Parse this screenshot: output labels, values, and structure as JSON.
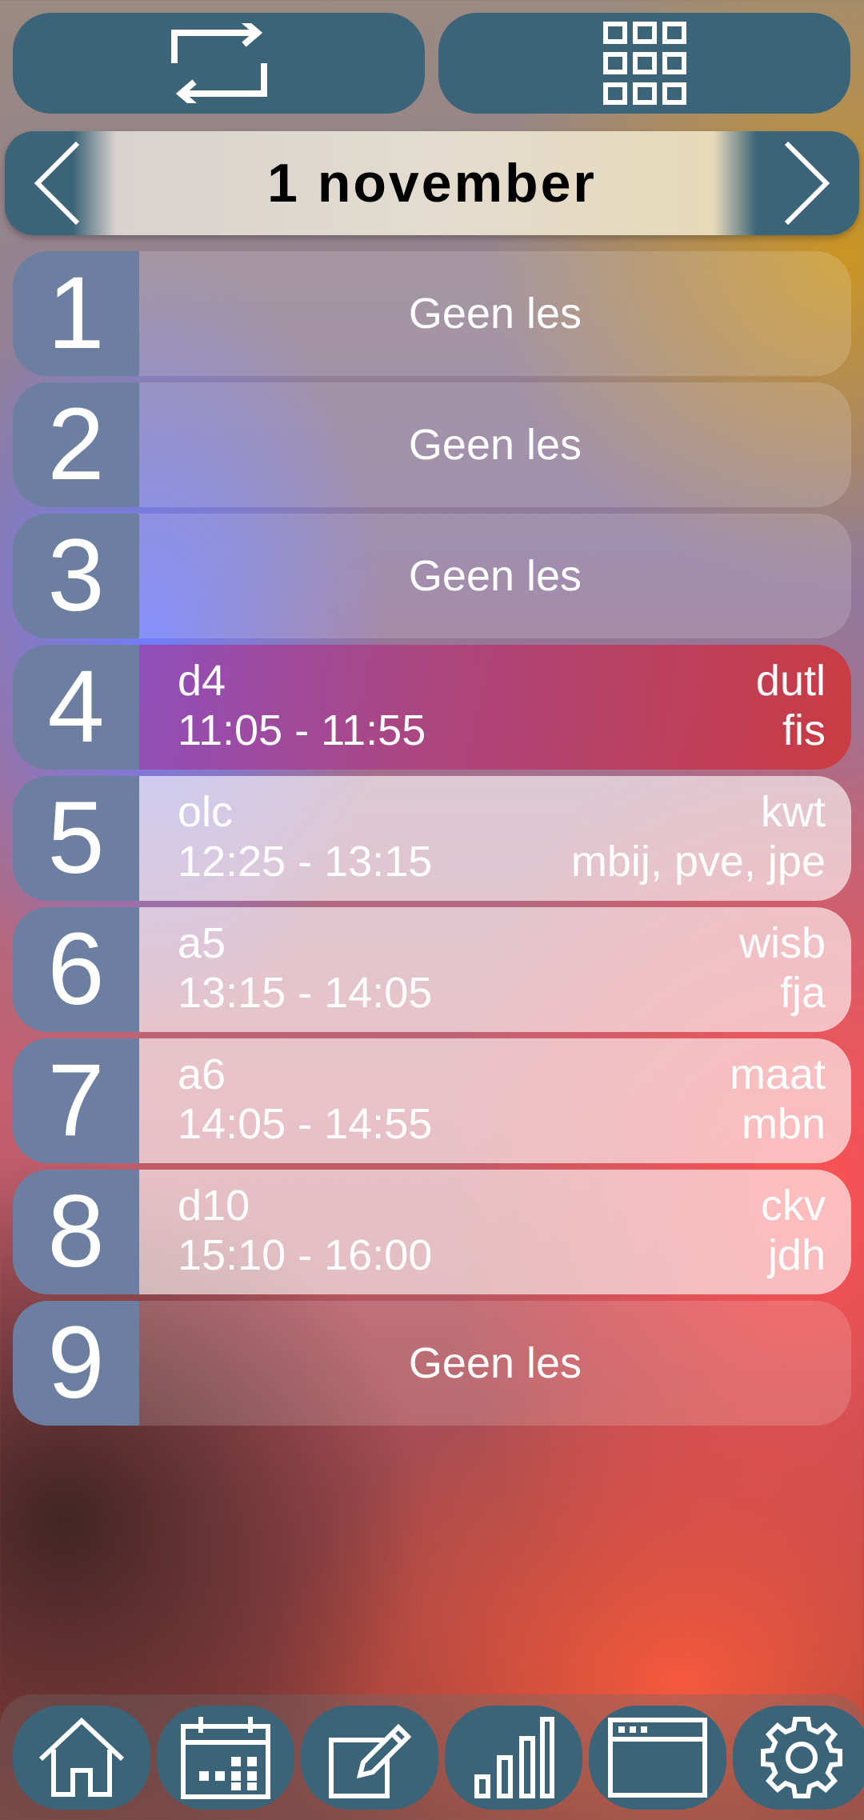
{
  "header": {
    "repeat_button_icon": "repeat-icon",
    "grid_button_icon": "grid-icon"
  },
  "datebar": {
    "date": "1 november",
    "prev_icon": "chevron-left-icon",
    "next_icon": "chevron-right-icon"
  },
  "lessons": [
    {
      "hour": "1",
      "empty_label": "Geen les"
    },
    {
      "hour": "2",
      "empty_label": "Geen les"
    },
    {
      "hour": "3",
      "empty_label": "Geen les"
    },
    {
      "hour": "4",
      "room": "d4",
      "time": "11:05 - 11:55",
      "subject": "dutl",
      "teacher": "fis"
    },
    {
      "hour": "5",
      "room": "olc",
      "time": "12:25 - 13:15",
      "subject": "kwt",
      "teacher": "mbij, pve, jpe"
    },
    {
      "hour": "6",
      "room": "a5",
      "time": "13:15 - 14:05",
      "subject": "wisb",
      "teacher": "fja"
    },
    {
      "hour": "7",
      "room": "a6",
      "time": "14:05 - 14:55",
      "subject": "maat",
      "teacher": "mbn"
    },
    {
      "hour": "8",
      "room": "d10",
      "time": "15:10 - 16:00",
      "subject": "ckv",
      "teacher": "jdh"
    },
    {
      "hour": "9",
      "empty_label": "Geen les"
    }
  ],
  "bottom_nav": {
    "items": [
      "home-icon",
      "calendar-icon",
      "edit-icon",
      "bar-chart-icon",
      "browser-window-icon",
      "settings-icon"
    ]
  },
  "colors": {
    "button_bg": "#3c6479",
    "hour_bg": "#6c7fa0",
    "current_lesson_start": "#9646af",
    "current_lesson_end": "#cd373c"
  }
}
